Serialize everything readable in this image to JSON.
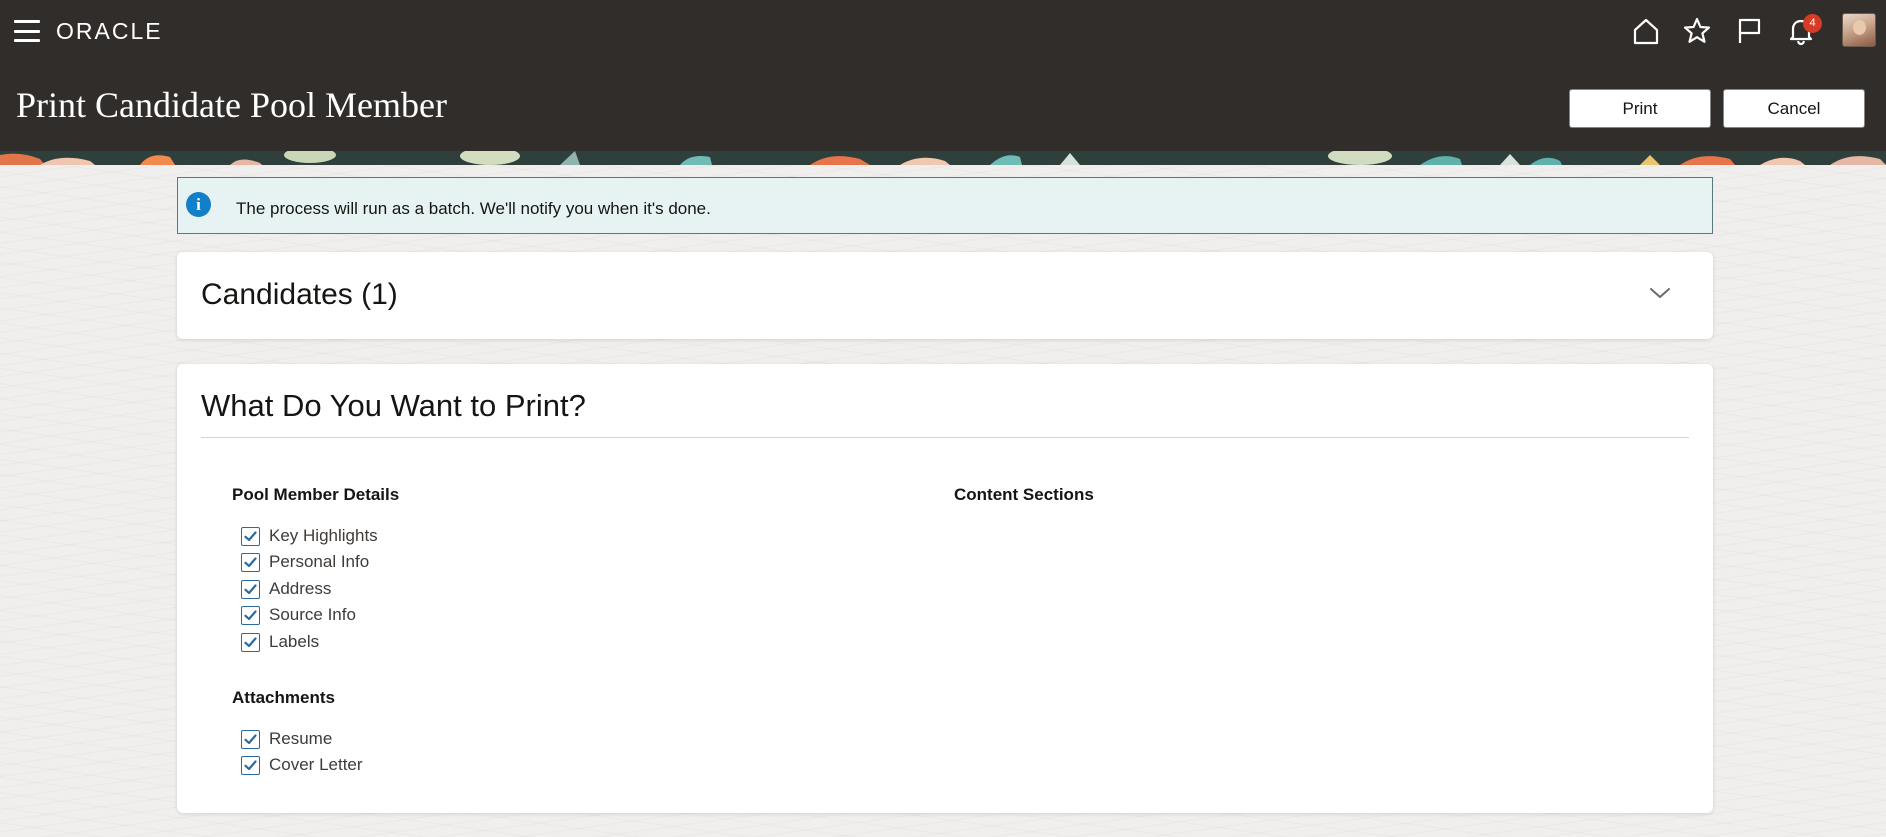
{
  "header": {
    "logo": "ORACLE",
    "page_title": "Print Candidate Pool Member",
    "print_label": "Print",
    "cancel_label": "Cancel",
    "notification_count": "4",
    "icons": [
      "menu-icon",
      "home-icon",
      "star-icon",
      "flag-icon",
      "bell-icon",
      "avatar"
    ]
  },
  "info": {
    "message": "The process will run as a batch. We'll notify you when it's done.",
    "icon": "info-icon"
  },
  "candidates": {
    "title": "Candidates (1)",
    "expanded": false
  },
  "print_options": {
    "title": "What Do You Want to Print?",
    "pool_member_details": {
      "label": "Pool Member Details",
      "items": [
        {
          "label": "Key Highlights",
          "checked": true
        },
        {
          "label": "Personal Info",
          "checked": true
        },
        {
          "label": "Address",
          "checked": true
        },
        {
          "label": "Source Info",
          "checked": true
        },
        {
          "label": "Labels",
          "checked": true
        }
      ]
    },
    "attachments": {
      "label": "Attachments",
      "items": [
        {
          "label": "Resume",
          "checked": true
        },
        {
          "label": "Cover Letter",
          "checked": true
        }
      ]
    },
    "content_sections": {
      "label": "Content Sections"
    }
  },
  "colors": {
    "header_bg": "#312d2a",
    "info_bg": "#e7f3f3",
    "info_icon": "#1180c8",
    "checkbox": "#2a6b9e",
    "badge": "#d63b25"
  }
}
